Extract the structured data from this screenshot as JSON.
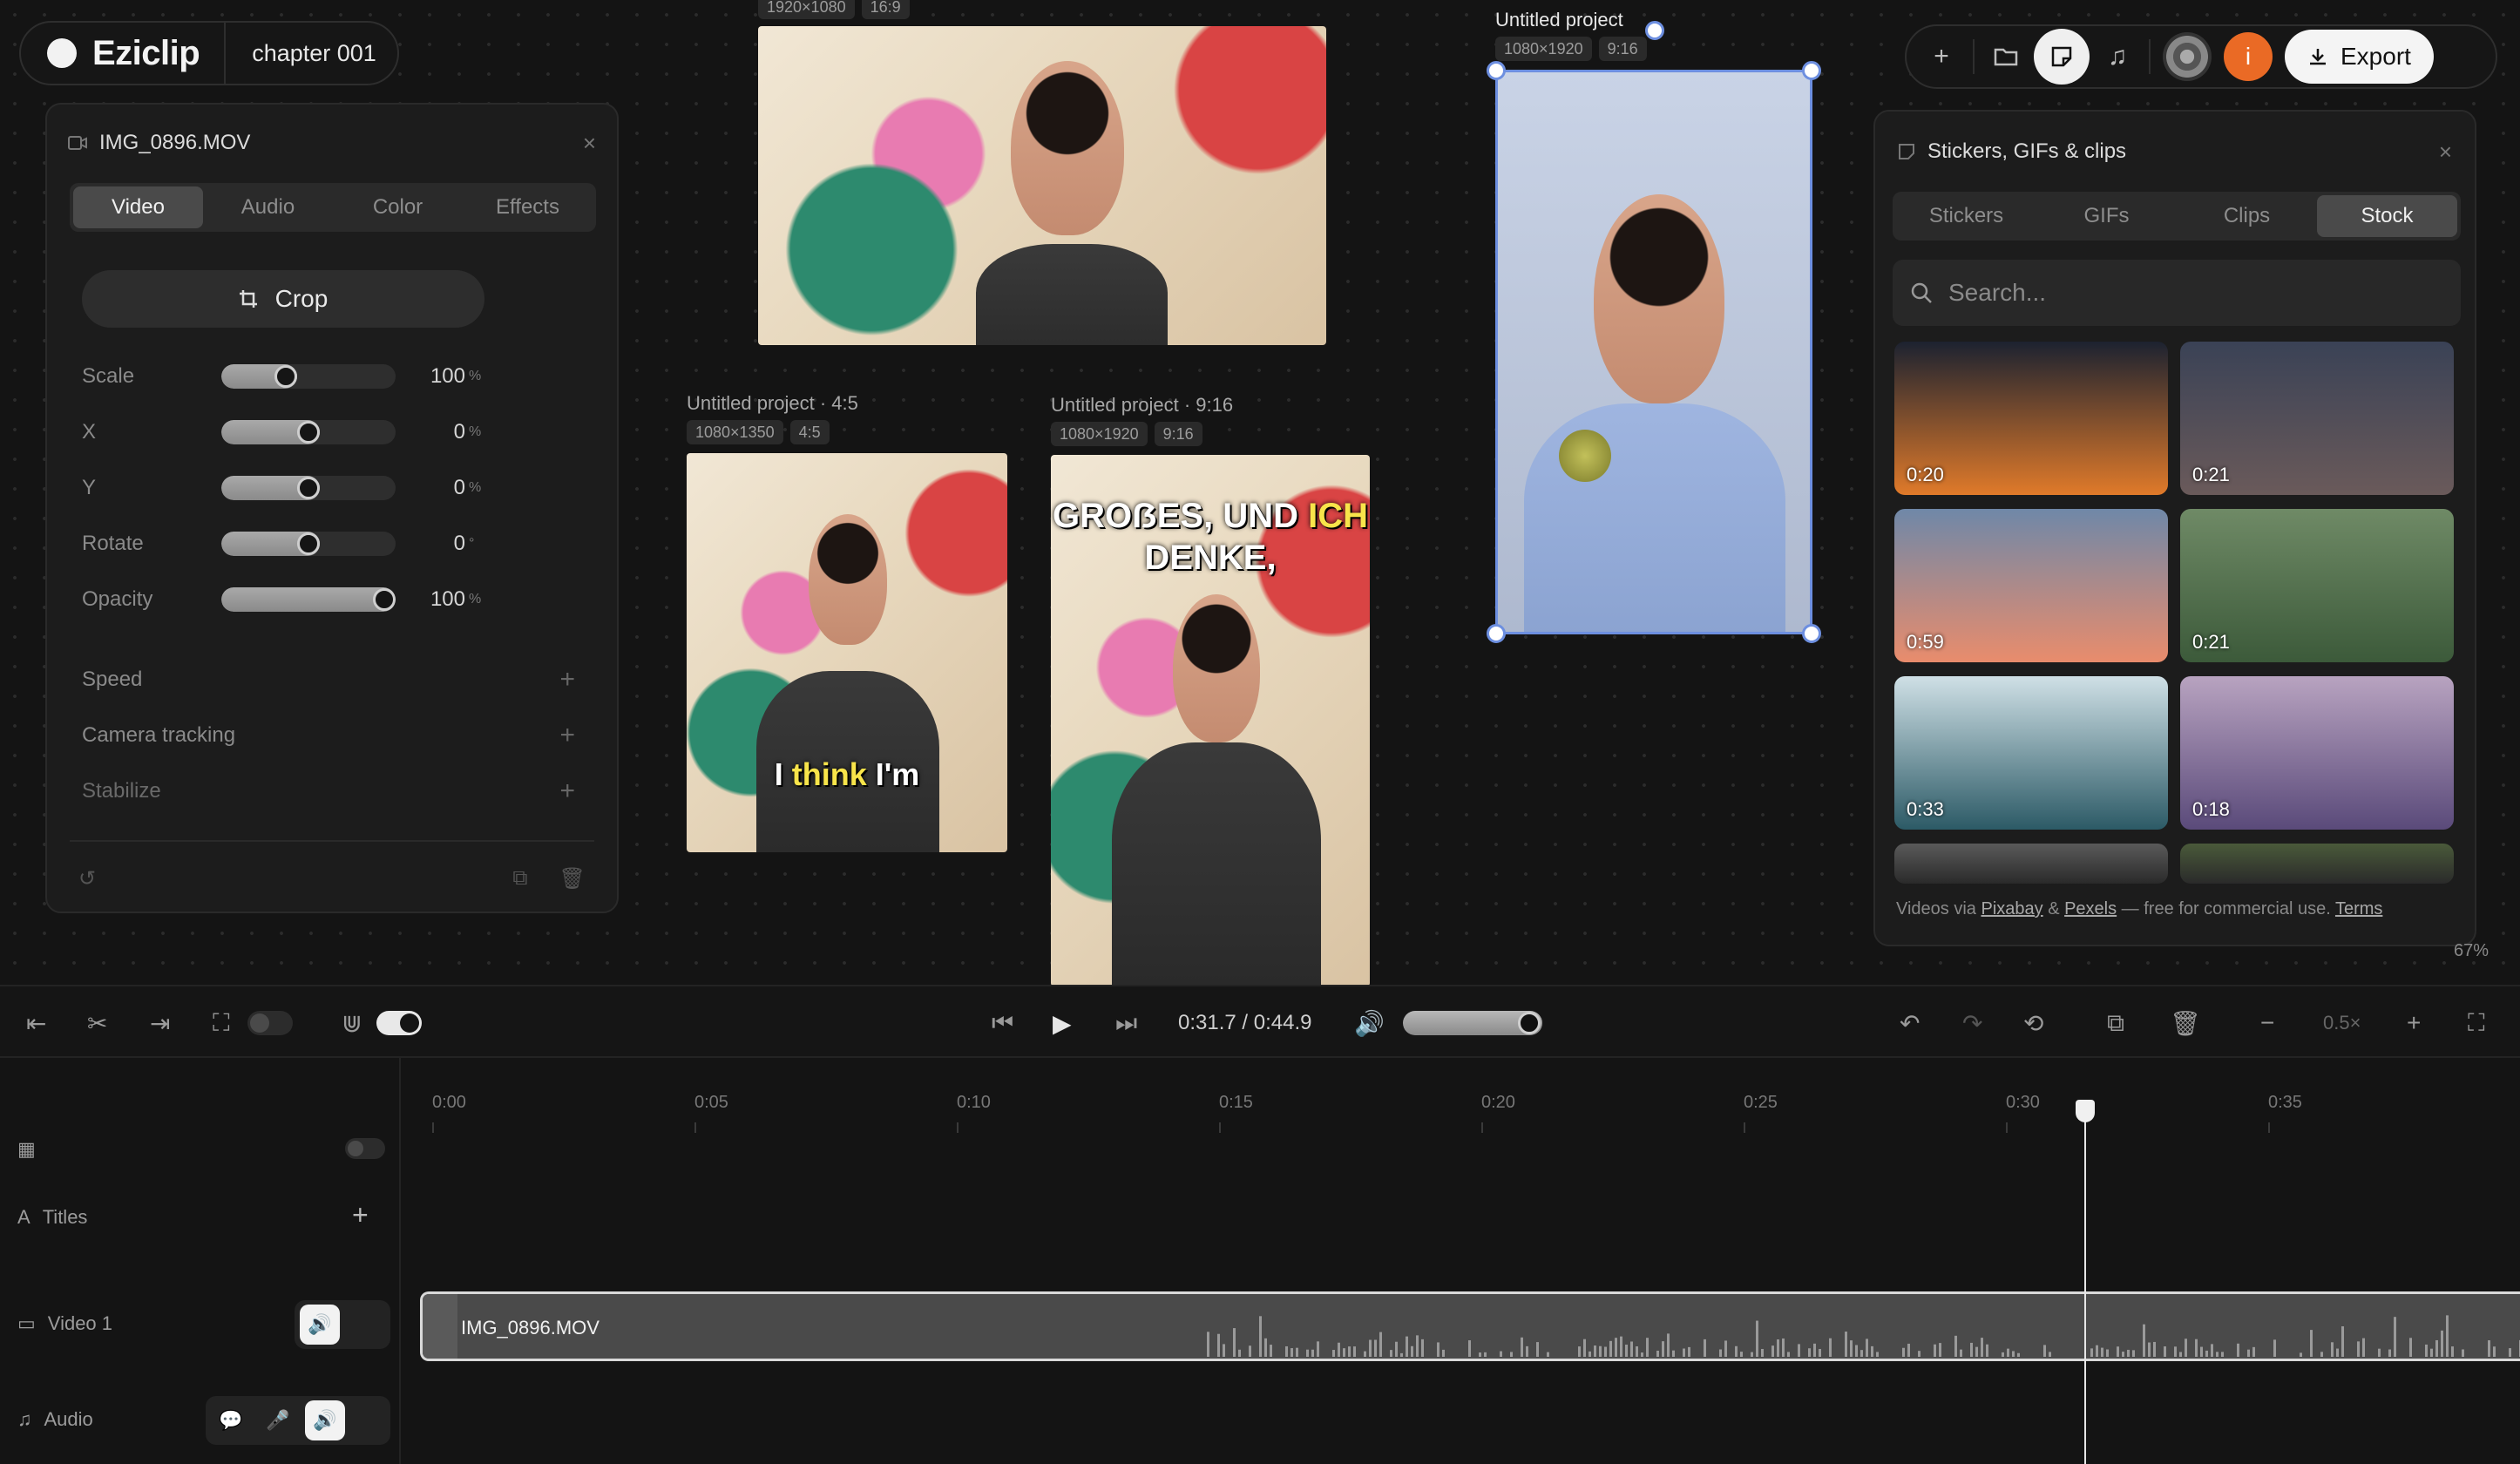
{
  "app": {
    "name": "Eziclip",
    "project": "chapter 001"
  },
  "properties": {
    "file_name": "IMG_0896.MOV",
    "tabs": [
      {
        "label": "Video",
        "active": true
      },
      {
        "label": "Audio",
        "active": false
      },
      {
        "label": "Color",
        "active": false
      },
      {
        "label": "Effects",
        "active": false
      }
    ],
    "crop_label": "Crop",
    "sliders": [
      {
        "label": "Scale",
        "value": "100",
        "unit": "%",
        "level": 0.35
      },
      {
        "label": "X",
        "value": "0",
        "unit": "%",
        "level": 0.5
      },
      {
        "label": "Y",
        "value": "0",
        "unit": "%",
        "level": 0.5
      },
      {
        "label": "Rotate",
        "value": "0",
        "unit": "°",
        "level": 0.5
      },
      {
        "label": "Opacity",
        "value": "100",
        "unit": "%",
        "level": 1.0
      }
    ],
    "expandables": [
      "Speed",
      "Camera tracking",
      "Stabilize"
    ]
  },
  "previews": {
    "top": {
      "res": "1920×1080",
      "ratio": "16:9"
    },
    "p45": {
      "title": "Untitled project · 4:5",
      "res": "1080×1350",
      "ratio": "4:5",
      "caption_a": "I ",
      "caption_hl": "think",
      "caption_b": " I'm"
    },
    "p916": {
      "title": "Untitled project · 9:16",
      "res": "1080×1920",
      "ratio": "9:16",
      "caption_line1_a": "GROẞES, UND ",
      "caption_line1_hl": "ICH",
      "caption_line2": "DENKE,"
    },
    "selected": {
      "title": "Untitled project",
      "res": "1080×1920",
      "ratio": "9:16"
    }
  },
  "toolbar": {
    "export_label": "Export",
    "avatar_letter": "i"
  },
  "stock_panel": {
    "title": "Stickers, GIFs & clips",
    "tabs": [
      {
        "label": "Stickers",
        "active": false
      },
      {
        "label": "GIFs",
        "active": false
      },
      {
        "label": "Clips",
        "active": false
      },
      {
        "label": "Stock",
        "active": true
      }
    ],
    "search_placeholder": "Search...",
    "thumbs": [
      {
        "duration": "0:20",
        "c1": "#1c2230",
        "c2": "#e07a2a"
      },
      {
        "duration": "0:21",
        "c1": "#3a4256",
        "c2": "#6a5a5a"
      },
      {
        "duration": "0:59",
        "c1": "#6f88a8",
        "c2": "#e98c6c"
      },
      {
        "duration": "0:21",
        "c1": "#6f8a66",
        "c2": "#3c5a3a"
      },
      {
        "duration": "0:33",
        "c1": "#cfe0e6",
        "c2": "#2c5a66"
      },
      {
        "duration": "0:18",
        "c1": "#b8a3c0",
        "c2": "#5a4a7a"
      }
    ],
    "credit_prefix": "Videos via ",
    "credit_pixabay": "Pixabay",
    "credit_and": " & ",
    "credit_pexels": "Pexels",
    "credit_suffix": " — free for commercial use. ",
    "credit_terms": "Terms"
  },
  "canvas_zoom": "67%",
  "playback": {
    "time": "0:31.7 / 0:44.9",
    "zoom": "0.5×"
  },
  "timeline": {
    "ticks": [
      "0:00",
      "0:05",
      "0:10",
      "0:15",
      "0:20",
      "0:25",
      "0:30",
      "0:35"
    ],
    "tracks": {
      "titles": "Titles",
      "video": "Video 1",
      "audio": "Audio"
    },
    "clip_name": "IMG_0896.MOV"
  }
}
